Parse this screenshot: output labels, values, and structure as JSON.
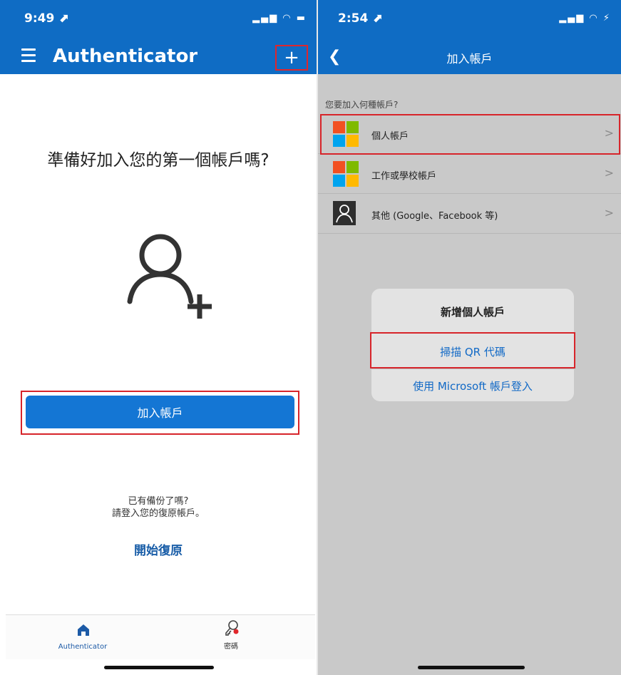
{
  "left": {
    "status": {
      "time": "9:49 ⬈",
      "icons": "▂▄▆ ◠ ▬"
    },
    "nav": {
      "title": "Authenticator",
      "add_symbol": "+"
    },
    "prompt": "準備好加入您的第一個帳戶嗎?",
    "add_account_button": "加入帳戶",
    "backup_line1": "已有備份了嗎?",
    "backup_line2": "請登入您的復原帳戶。",
    "recover_link": "開始復原",
    "tabs": [
      {
        "label": "Authenticator",
        "icon": "home-icon",
        "color": "#1c5aa6"
      },
      {
        "label": "密碼",
        "icon": "key-icon",
        "color": "#333333"
      }
    ]
  },
  "right": {
    "status": {
      "time": "2:54 ⬈",
      "icons": "▂▄▆ ◠ ⚡"
    },
    "nav": {
      "title": "加入帳戶",
      "back_icon": "chevron-left-icon"
    },
    "question": "您要加入何種帳戶?",
    "account_types": [
      {
        "label": "個人帳戶",
        "icon": "microsoft-logo-icon"
      },
      {
        "label": "工作或學校帳戶",
        "icon": "microsoft-logo-icon"
      },
      {
        "label": "其他 (Google、Facebook 等)",
        "icon": "person-icon"
      }
    ],
    "sheet": {
      "title": "新增個人帳戶",
      "options": [
        "掃描 QR 代碼",
        "使用 Microsoft 帳戶登入"
      ]
    }
  },
  "colors": {
    "brand_blue": "#0f6cc4",
    "highlight_red": "#d7242a",
    "link_blue": "#1169c6"
  }
}
